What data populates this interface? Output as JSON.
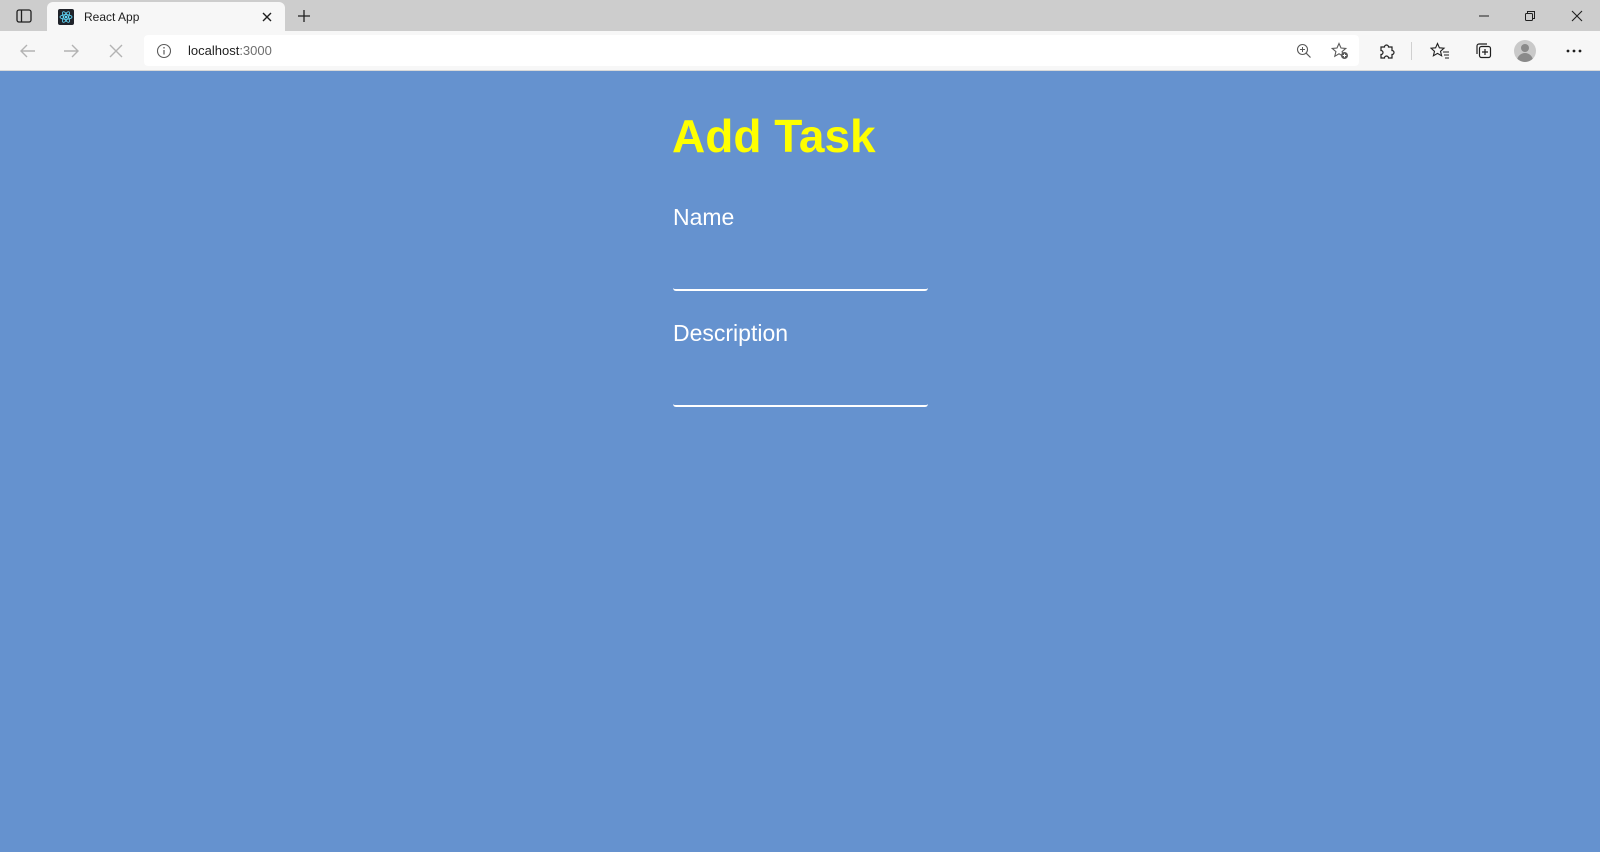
{
  "browser": {
    "tab": {
      "title": "React App"
    },
    "address": {
      "host": "localhost",
      "port": ":3000"
    }
  },
  "icons": {
    "tab_actions": "tab-actions-icon",
    "favicon": "react-logo-icon",
    "tab_close": "close-icon",
    "new_tab": "plus-icon",
    "back": "arrow-left-icon",
    "forward": "arrow-right-icon",
    "stop": "close-icon",
    "site_info": "info-icon",
    "zoom": "zoom-in-icon",
    "add_favorite": "star-add-icon",
    "extensions": "puzzle-icon",
    "favorites": "favorites-icon",
    "collections": "collections-icon",
    "profile": "avatar-icon",
    "more": "ellipsis-icon",
    "minimize": "minimize-icon",
    "restore": "restore-icon",
    "close_window": "close-icon"
  },
  "app": {
    "title": "Add Task",
    "fields": [
      {
        "label": "Name",
        "value": ""
      },
      {
        "label": "Description",
        "value": ""
      }
    ]
  },
  "colors": {
    "background": "#6592cf",
    "title": "#ffff00",
    "text": "#ffffff"
  }
}
